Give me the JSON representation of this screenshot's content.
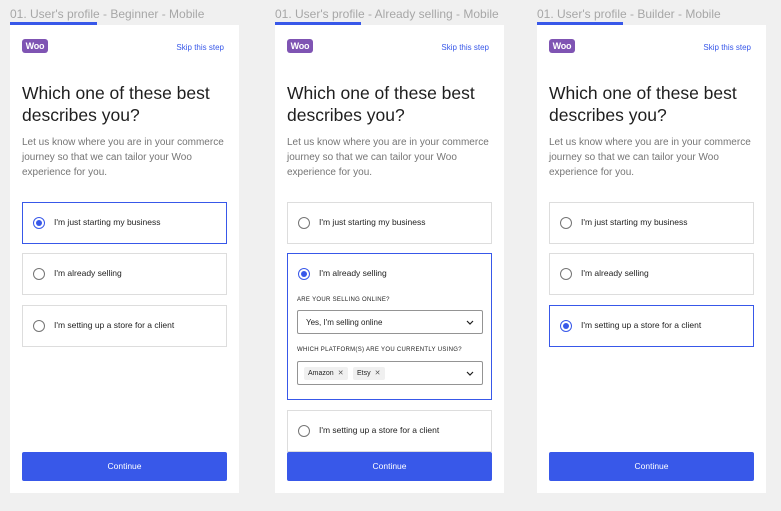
{
  "frames": [
    {
      "label": "01. User's profile - Beginner - Mobile",
      "skip": "Skip this step",
      "heading": "Which one of these best describes you?",
      "subtext": "Let us know where you are in your commerce journey so that we can tailor your Woo experience for you.",
      "options": [
        "I'm just starting my business",
        "I'm already selling",
        "I'm setting up a store for a client"
      ],
      "selected": 0,
      "continue": "Continue"
    },
    {
      "label": "01. User's profile - Already selling - Mobile",
      "skip": "Skip this step",
      "heading": "Which one of these best describes you?",
      "subtext": "Let us know where you are in your commerce journey so that we can tailor your Woo experience for you.",
      "options": [
        "I'm just starting my business",
        "I'm already selling",
        "I'm setting up a store for a client"
      ],
      "selected": 1,
      "selling_online": {
        "label": "ARE YOUR SELLING ONLINE?",
        "value": "Yes, I'm selling online"
      },
      "platforms": {
        "label": "WHICH PLATFORM(S) ARE YOU CURRENTLY USING?",
        "chips": [
          "Amazon",
          "Etsy"
        ]
      },
      "continue": "Continue"
    },
    {
      "label": "01. User's profile - Builder - Mobile",
      "skip": "Skip this step",
      "heading": "Which one of these best describes you?",
      "subtext": "Let us know where you are in your commerce journey so that we can tailor your Woo experience for you.",
      "options": [
        "I'm just starting my business",
        "I'm already selling",
        "I'm setting up a store for a client"
      ],
      "selected": 2,
      "continue": "Continue"
    }
  ],
  "logo_text": "Woo",
  "colors": {
    "accent": "#3858e9",
    "brand": "#7f54b3",
    "background": "#f0f0f0"
  },
  "icons": {
    "chips_remove": "close-icon",
    "dropdown": "chevron-down-icon"
  }
}
